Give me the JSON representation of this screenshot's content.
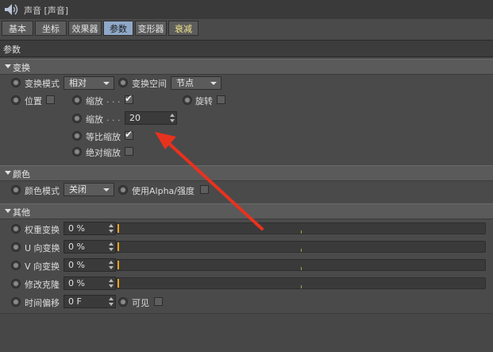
{
  "window": {
    "title": "声音 [声音]"
  },
  "tabs": [
    {
      "label": "基本"
    },
    {
      "label": "坐标"
    },
    {
      "label": "效果器"
    },
    {
      "label": "参数"
    },
    {
      "label": "变形器"
    },
    {
      "label": "衰减"
    }
  ],
  "active_tab": "参数",
  "section_title": "参数",
  "transform": {
    "header": "变换",
    "mode_label": "变换模式",
    "mode_value": "相对",
    "space_label": "变换空间",
    "space_value": "节点",
    "position_label": "位置",
    "scale_label": "缩放",
    "scale_dots": ". . .",
    "rotation_label": "旋转",
    "scale_value_label": "缩放",
    "scale_value_dots": ". . .",
    "scale_value": "20",
    "uniform_scale_label": "等比缩放",
    "absolute_scale_label": "绝对缩放"
  },
  "color": {
    "header": "颜色",
    "mode_label": "颜色模式",
    "mode_value": "关闭",
    "use_alpha_label": "使用Alpha/强度"
  },
  "other": {
    "header": "其他",
    "rows": [
      {
        "label": "权重变换",
        "value": "0 %",
        "level": 0
      },
      {
        "label": "U 向变换",
        "value": "0 %",
        "level": 0
      },
      {
        "label": "V 向变换",
        "value": "0 %",
        "level": 0
      },
      {
        "label": "修改克隆",
        "value": "0 %",
        "level": 0
      }
    ],
    "time_offset_label": "时间偏移",
    "time_offset_value": "0 F",
    "visible_label": "可见"
  },
  "colors": {
    "background": "#4a4a4a",
    "active_tab": "#8fa8c8",
    "highlight_tab_text": "#f0e28a",
    "slider_thumb": "#e8a020",
    "annotation_arrow": "#e8321e"
  }
}
